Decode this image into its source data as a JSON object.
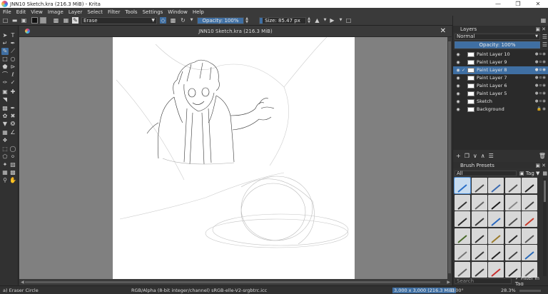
{
  "window": {
    "title": "JNN10 Sketch.kra (216.3 MiB)  - Krita",
    "minimize": "—",
    "maximize": "❒",
    "close": "✕"
  },
  "menu": [
    "File",
    "Edit",
    "View",
    "Image",
    "Layer",
    "Select",
    "Filter",
    "Tools",
    "Settings",
    "Window",
    "Help"
  ],
  "toolbar": {
    "brush_preset": "Erase",
    "opacity_label": "Opacity: 100%",
    "opacity_value": 1.0,
    "size_label": "Size: 85.47 px",
    "size_fraction": 0.06
  },
  "document": {
    "tab_title": "JNN10 Sketch.kra (216.3 MiB)",
    "close": "✕"
  },
  "layers": {
    "panel_title": "Layers",
    "blend_mode": "Normal",
    "opacity_label": "Opacity:  100%",
    "items": [
      {
        "name": "Paint Layer 10",
        "active": false
      },
      {
        "name": "Paint Layer 9",
        "active": false
      },
      {
        "name": "Paint Layer 8",
        "active": true
      },
      {
        "name": "Paint Layer 7",
        "active": false
      },
      {
        "name": "Paint Layer 6",
        "active": false
      },
      {
        "name": "Paint Layer 5",
        "active": false
      },
      {
        "name": "Sketch",
        "active": false
      },
      {
        "name": "Background",
        "active": false
      }
    ]
  },
  "brush_presets": {
    "panel_title": "Brush Presets",
    "filter": "All",
    "tag_label": "Tag",
    "search_placeholder": "Search",
    "filter_in_tag": "Filter in Tag",
    "colors": [
      "#2a70c8",
      "#4a4a4a",
      "#3a6ab0",
      "#555555",
      "#222222",
      "#333333",
      "#666666",
      "#1a1a1a",
      "#888888",
      "#444444",
      "#2a2a2a",
      "#3a3a3a",
      "#2868c0",
      "#505050",
      "#c83a2a",
      "#4a6a2a",
      "#333333",
      "#9a7a2a",
      "#2a2a2a",
      "#5a5a5a",
      "#777777",
      "#3a3a3a",
      "#222222",
      "#444444",
      "#2a6ab8",
      "#666666",
      "#3a3a3a",
      "#c83030",
      "#2a2a2a",
      "#555555"
    ]
  },
  "status": {
    "tool": "a) Eraser Circle",
    "color_info": "RGB/Alpha (8-bit integer/channel)  sRGB-elle-V2-srgbtrc.icc",
    "image_info": "3,000 x 3,000 (216.3 MiB)",
    "rotation": "0.00°",
    "zoom": "28.3%"
  }
}
